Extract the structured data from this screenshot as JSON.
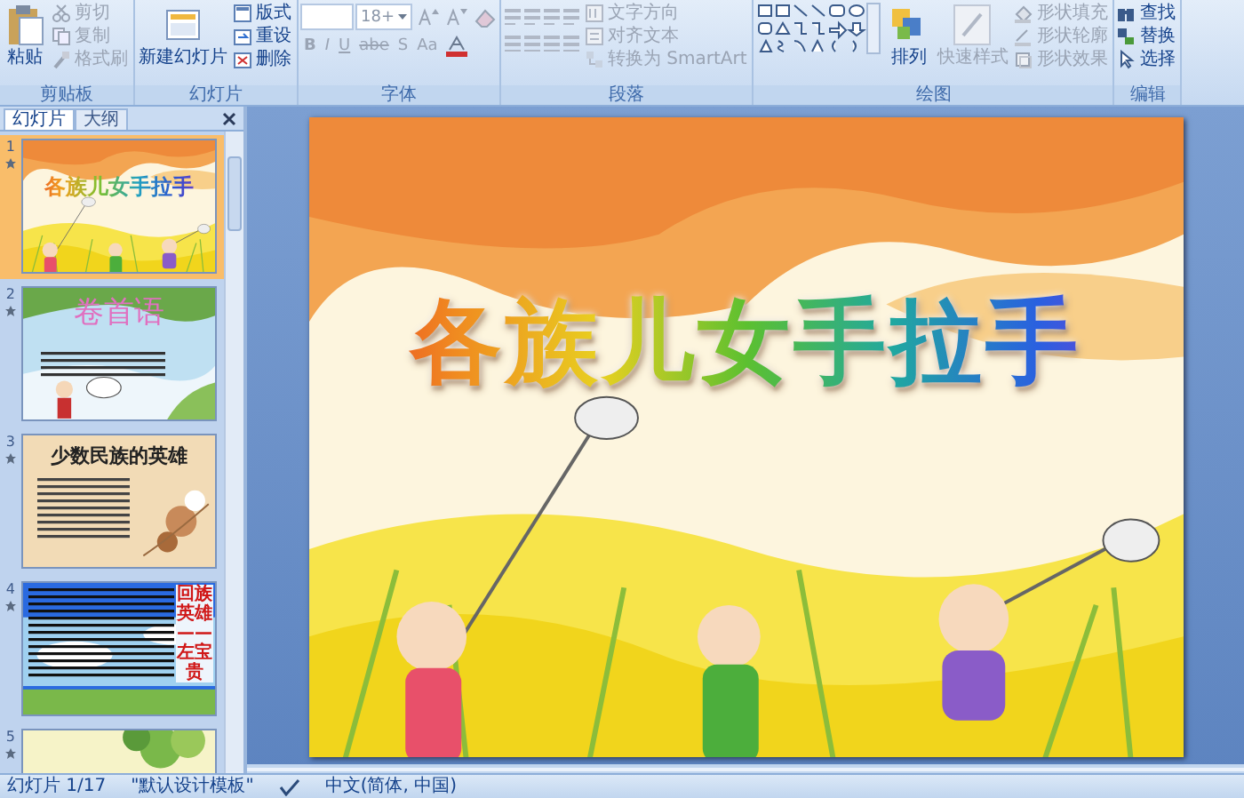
{
  "ribbon": {
    "groups": [
      {
        "label": "剪贴板",
        "large": [
          {
            "label": "粘贴",
            "disabled": false
          }
        ],
        "small": [
          {
            "label": "剪切",
            "disabled": true
          },
          {
            "label": "复制",
            "disabled": true
          },
          {
            "label": "格式刷",
            "disabled": true
          }
        ]
      },
      {
        "label": "幻灯片",
        "large": [
          {
            "label": "新建幻灯片",
            "disabled": false
          }
        ],
        "small": [
          {
            "label": "版式",
            "disabled": false
          },
          {
            "label": "重设",
            "disabled": false
          },
          {
            "label": "删除",
            "disabled": false
          }
        ]
      },
      {
        "label": "字体",
        "font_size": "18+",
        "format_buttons": [
          "B",
          "I",
          "U",
          "abe",
          "S",
          "Aa"
        ]
      },
      {
        "label": "段落",
        "small": [
          {
            "label": "文字方向",
            "disabled": true
          },
          {
            "label": "对齐文本",
            "disabled": true
          },
          {
            "label": "转换为 SmartArt",
            "disabled": true
          }
        ]
      },
      {
        "label": "绘图",
        "large": [
          {
            "label": "排列",
            "disabled": false
          },
          {
            "label": "快速样式",
            "disabled": true
          }
        ],
        "small": [
          {
            "label": "形状填充",
            "disabled": true
          },
          {
            "label": "形状轮廓",
            "disabled": true
          },
          {
            "label": "形状效果",
            "disabled": true
          }
        ]
      },
      {
        "label": "编辑",
        "small": [
          {
            "label": "查找",
            "disabled": false
          },
          {
            "label": "替换",
            "disabled": false
          },
          {
            "label": "选择",
            "disabled": false
          }
        ]
      }
    ]
  },
  "panel": {
    "tabs": [
      {
        "label": "幻灯片",
        "selected": true
      },
      {
        "label": "大纲",
        "selected": false
      }
    ]
  },
  "slides": [
    {
      "number": "1",
      "selected": true,
      "kind": "festival",
      "title": "各族儿女手拉手"
    },
    {
      "number": "2",
      "selected": false,
      "kind": "sky",
      "title": "卷首语"
    },
    {
      "number": "3",
      "selected": false,
      "kind": "parchment",
      "title": "少数民族的英雄"
    },
    {
      "number": "4",
      "selected": false,
      "kind": "blue",
      "title": "回族英雄——左宝贵"
    },
    {
      "number": "5",
      "selected": false,
      "kind": "leaves"
    }
  ],
  "current_slide": {
    "title": "各族儿女手拉手"
  },
  "status_bar": {
    "slide": "幻灯片 1/17",
    "theme": "\"默认设计模板\"",
    "language": "中文(简体, 中国)"
  }
}
